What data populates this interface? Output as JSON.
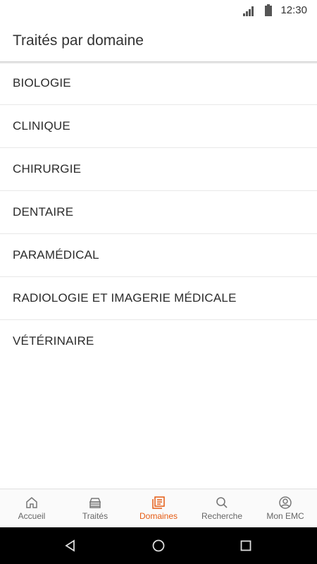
{
  "status_bar": {
    "time": "12:30"
  },
  "app_bar": {
    "title": "Traités par domaine"
  },
  "domains": [
    {
      "label": "BIOLOGIE"
    },
    {
      "label": "CLINIQUE"
    },
    {
      "label": "CHIRURGIE"
    },
    {
      "label": "DENTAIRE"
    },
    {
      "label": "PARAMÉDICAL"
    },
    {
      "label": "RADIOLOGIE ET IMAGERIE MÉDICALE"
    },
    {
      "label": "VÉTÉRINAIRE"
    }
  ],
  "tabs": [
    {
      "label": "Accueil",
      "icon": "home-icon"
    },
    {
      "label": "Traités",
      "icon": "books-icon"
    },
    {
      "label": "Domaines",
      "icon": "domains-icon",
      "active": true
    },
    {
      "label": "Recherche",
      "icon": "search-icon"
    },
    {
      "label": "Mon EMC",
      "icon": "account-icon"
    }
  ],
  "colors": {
    "accent": "#e55b13"
  }
}
